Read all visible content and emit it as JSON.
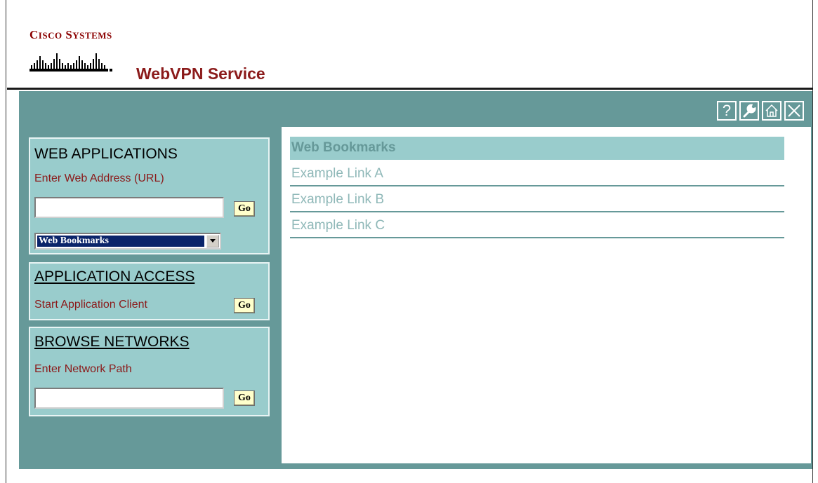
{
  "header": {
    "brand_first": "C",
    "brand_first_rest": "ISCO",
    "brand_second": "S",
    "brand_second_rest": "YSTEMS",
    "app_title": "WebVPN Service"
  },
  "toolbar": {
    "buttons": [
      {
        "icon": "help-icon",
        "glyph": "?"
      },
      {
        "icon": "wrench-icon"
      },
      {
        "icon": "home-icon"
      },
      {
        "icon": "close-icon"
      }
    ]
  },
  "web_applications": {
    "title": "WEB APPLICATIONS",
    "label": "Enter Web Address (URL)",
    "url_value": "",
    "go_label": "Go",
    "select_value": "Web Bookmarks"
  },
  "application_access": {
    "title": "APPLICATION ACCESS",
    "label": "Start Application Client",
    "go_label": "Go"
  },
  "browse_networks": {
    "title": "BROWSE NETWORKS",
    "label": "Enter Network Path",
    "path_value": "",
    "go_label": "Go"
  },
  "bookmarks": {
    "header": "Web Bookmarks",
    "links": [
      "Example Link A",
      "Example Link B",
      "Example Link C"
    ]
  },
  "colors": {
    "panel": "#669999",
    "card": "#99cccc",
    "brand_red": "#8b0000",
    "go_button": "#ffffcc",
    "select_highlight": "#0a246a"
  }
}
